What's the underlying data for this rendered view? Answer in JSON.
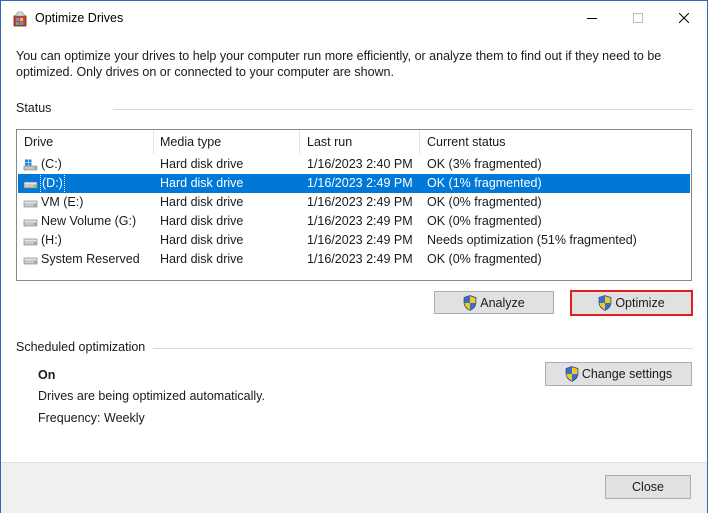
{
  "window": {
    "title": "Optimize Drives"
  },
  "description": "You can optimize your drives to help your computer run more efficiently, or analyze them to find out if they need to be optimized. Only drives on or connected to your computer are shown.",
  "status_section": {
    "label": "Status",
    "columns": [
      "Drive",
      "Media type",
      "Last run",
      "Current status"
    ],
    "selected_index": 1,
    "drives": [
      {
        "icon": "windows-drive-icon",
        "name": "(C:)",
        "media": "Hard disk drive",
        "last_run": "1/16/2023 2:40 PM",
        "status": "OK (3% fragmented)"
      },
      {
        "icon": "hard-drive-icon",
        "name": "(D:)",
        "media": "Hard disk drive",
        "last_run": "1/16/2023 2:49 PM",
        "status": "OK (1% fragmented)"
      },
      {
        "icon": "hard-drive-icon",
        "name": "VM (E:)",
        "media": "Hard disk drive",
        "last_run": "1/16/2023 2:49 PM",
        "status": "OK (0% fragmented)"
      },
      {
        "icon": "hard-drive-icon",
        "name": "New Volume (G:)",
        "media": "Hard disk drive",
        "last_run": "1/16/2023 2:49 PM",
        "status": "OK (0% fragmented)"
      },
      {
        "icon": "hard-drive-icon",
        "name": "(H:)",
        "media": "Hard disk drive",
        "last_run": "1/16/2023 2:49 PM",
        "status": "Needs optimization (51% fragmented)"
      },
      {
        "icon": "hard-drive-icon",
        "name": "System Reserved",
        "media": "Hard disk drive",
        "last_run": "1/16/2023 2:49 PM",
        "status": "OK (0% fragmented)"
      }
    ],
    "analyze_label": "Analyze",
    "optimize_label": "Optimize"
  },
  "scheduled": {
    "label": "Scheduled optimization",
    "state": "On",
    "description": "Drives are being optimized automatically.",
    "frequency": "Frequency: Weekly",
    "change_settings_label": "Change settings"
  },
  "footer": {
    "close_label": "Close"
  },
  "colors": {
    "selection": "#0078d7",
    "highlight_border": "#e02020",
    "window_border": "#2b6cb0"
  }
}
